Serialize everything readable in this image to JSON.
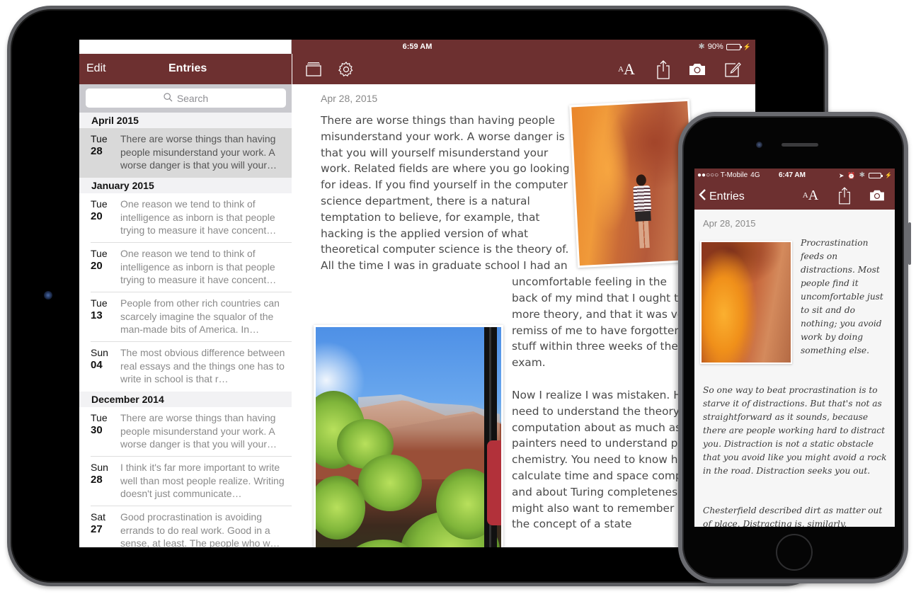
{
  "ipad": {
    "status_bar": {
      "device": "iPad",
      "time": "6:59 AM",
      "battery": "90%",
      "battery_level": 0.9
    },
    "sidebar": {
      "edit_label": "Edit",
      "title": "Entries",
      "search_placeholder": "Search",
      "sections": [
        {
          "header": "April 2015",
          "entries": [
            {
              "day": "Tue",
              "date": "28",
              "snippet": "There are worse things than having people misunderstand your work. A worse danger is that you will your…",
              "selected": true
            }
          ]
        },
        {
          "header": "January 2015",
          "entries": [
            {
              "day": "Tue",
              "date": "20",
              "snippet": "One reason we tend to think of intelligence as inborn is that people trying to measure it have concent…"
            },
            {
              "day": "Tue",
              "date": "20",
              "snippet": "One reason we tend to think of intelligence as inborn is that people trying to measure it have concent…"
            },
            {
              "day": "Tue",
              "date": "13",
              "snippet": "People from other rich countries can scarcely imagine the squalor of the man-made bits of America. In…"
            },
            {
              "day": "Sun",
              "date": "04",
              "snippet": "The most obvious difference between real essays and the things one has to write in school is that r…"
            }
          ]
        },
        {
          "header": "December 2014",
          "entries": [
            {
              "day": "Tue",
              "date": "30",
              "snippet": "There are worse things than having people misunderstand your work. A worse danger is that you will your…"
            },
            {
              "day": "Sun",
              "date": "28",
              "snippet": "I think it's far more important to write well than most people realize. Writing doesn't just communicate…"
            },
            {
              "day": "Sat",
              "date": "27",
              "snippet": "Good procrastination is avoiding errands to do real work. Good in a sense, at least. The people who w…"
            }
          ]
        }
      ]
    },
    "toolbar": {
      "icons": [
        "journals-icon",
        "settings-icon",
        "text-size-icon",
        "share-icon",
        "camera-icon",
        "compose-icon"
      ],
      "text_size_small": "A",
      "text_size_big": "A"
    },
    "entry": {
      "date": "Apr 28, 2015",
      "para_top": "There are worse things than having people misunderstand your work. A worse danger is that you will yourself misunderstand your work. Related fields are where you go looking for ideas. If you find yourself in the computer science department, there is a natural temptation to believe, for example, that hacking is the applied version of what theoretical computer science is the theory of. All the time I was in graduate school I had an",
      "para_cont_first": "uncomfortable feeling in the",
      "para_cont_rest": "back of my mind that I ought to know more theory, and that it was very remiss of me to have forgotten all that stuff within three weeks of the final exam.",
      "para_bottom": "Now I realize I was mistaken. Hackers need to understand the theory of computation about as much as painters need to understand paint chemistry. You need to know how to calculate time and space complexity and about Turing completeness. You might also want to remember at least the concept of a state",
      "photos": [
        "canyon-portrait-photo",
        "zion-cliffs-photo"
      ]
    }
  },
  "iphone": {
    "status_bar": {
      "carrier": "●●○○○ T-Mobile",
      "network": "4G",
      "time": "6:47 AM"
    },
    "nav": {
      "back_label": "Entries",
      "text_size_small": "A",
      "text_size_big": "A"
    },
    "entry": {
      "date": "Apr 28, 2015",
      "para1": "Procrastination feeds on distractions. Most people find it uncomfortable just to sit and do nothing; you avoid work by doing something else.",
      "para2": "So one way to beat procrastination is to starve it of distractions. But that's not as straightforward as it sounds, because there are people working hard to distract you. Distraction is not a static obstacle that you avoid like you might avoid a rock in the road. Distraction seeks you out.",
      "para3": "Chesterfield described dirt as matter out of place. Distracting is, similarly,"
    }
  },
  "colors": {
    "brand_maroon": "#6d3030",
    "battery_green": "#4cd964"
  }
}
